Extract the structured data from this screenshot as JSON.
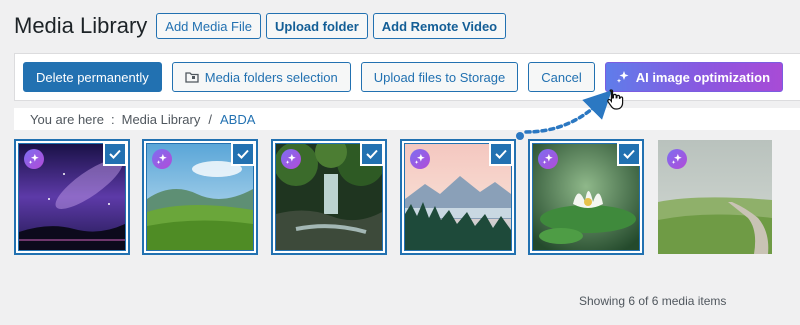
{
  "header": {
    "title": "Media Library",
    "actions": [
      "Add Media File",
      "Upload folder",
      "Add Remote Video"
    ]
  },
  "toolbar": {
    "delete_label": "Delete permanently",
    "folders_label": "Media folders selection",
    "storage_label": "Upload files to Storage",
    "cancel_label": "Cancel",
    "ai_label": "AI image optimization"
  },
  "breadcrumb": {
    "prefix": "You are here",
    "separator": ":",
    "root": "Media Library",
    "slash": "/",
    "current": "ABDA"
  },
  "media": {
    "items": [
      {
        "scene": "galaxy-night",
        "selected": true,
        "ai_icon": "sparkle-icon"
      },
      {
        "scene": "green-hills",
        "selected": true,
        "ai_icon": "sparkle-icon"
      },
      {
        "scene": "forest-waterfall",
        "selected": true,
        "ai_icon": "sparkle-icon"
      },
      {
        "scene": "mountain-lake-sunset",
        "selected": true,
        "ai_icon": "sparkle-icon"
      },
      {
        "scene": "water-lily",
        "selected": true,
        "ai_icon": "sparkle-icon"
      },
      {
        "scene": "foggy-road-meadow",
        "selected": false,
        "ai_icon": "sparkle-icon"
      }
    ],
    "count_text": "Showing 6 of 6 media items"
  },
  "colors": {
    "accent": "#2271b1",
    "ai_gradient_start": "#5f7dea",
    "ai_gradient_end": "#a84bd6",
    "background": "#f0f0f1"
  }
}
